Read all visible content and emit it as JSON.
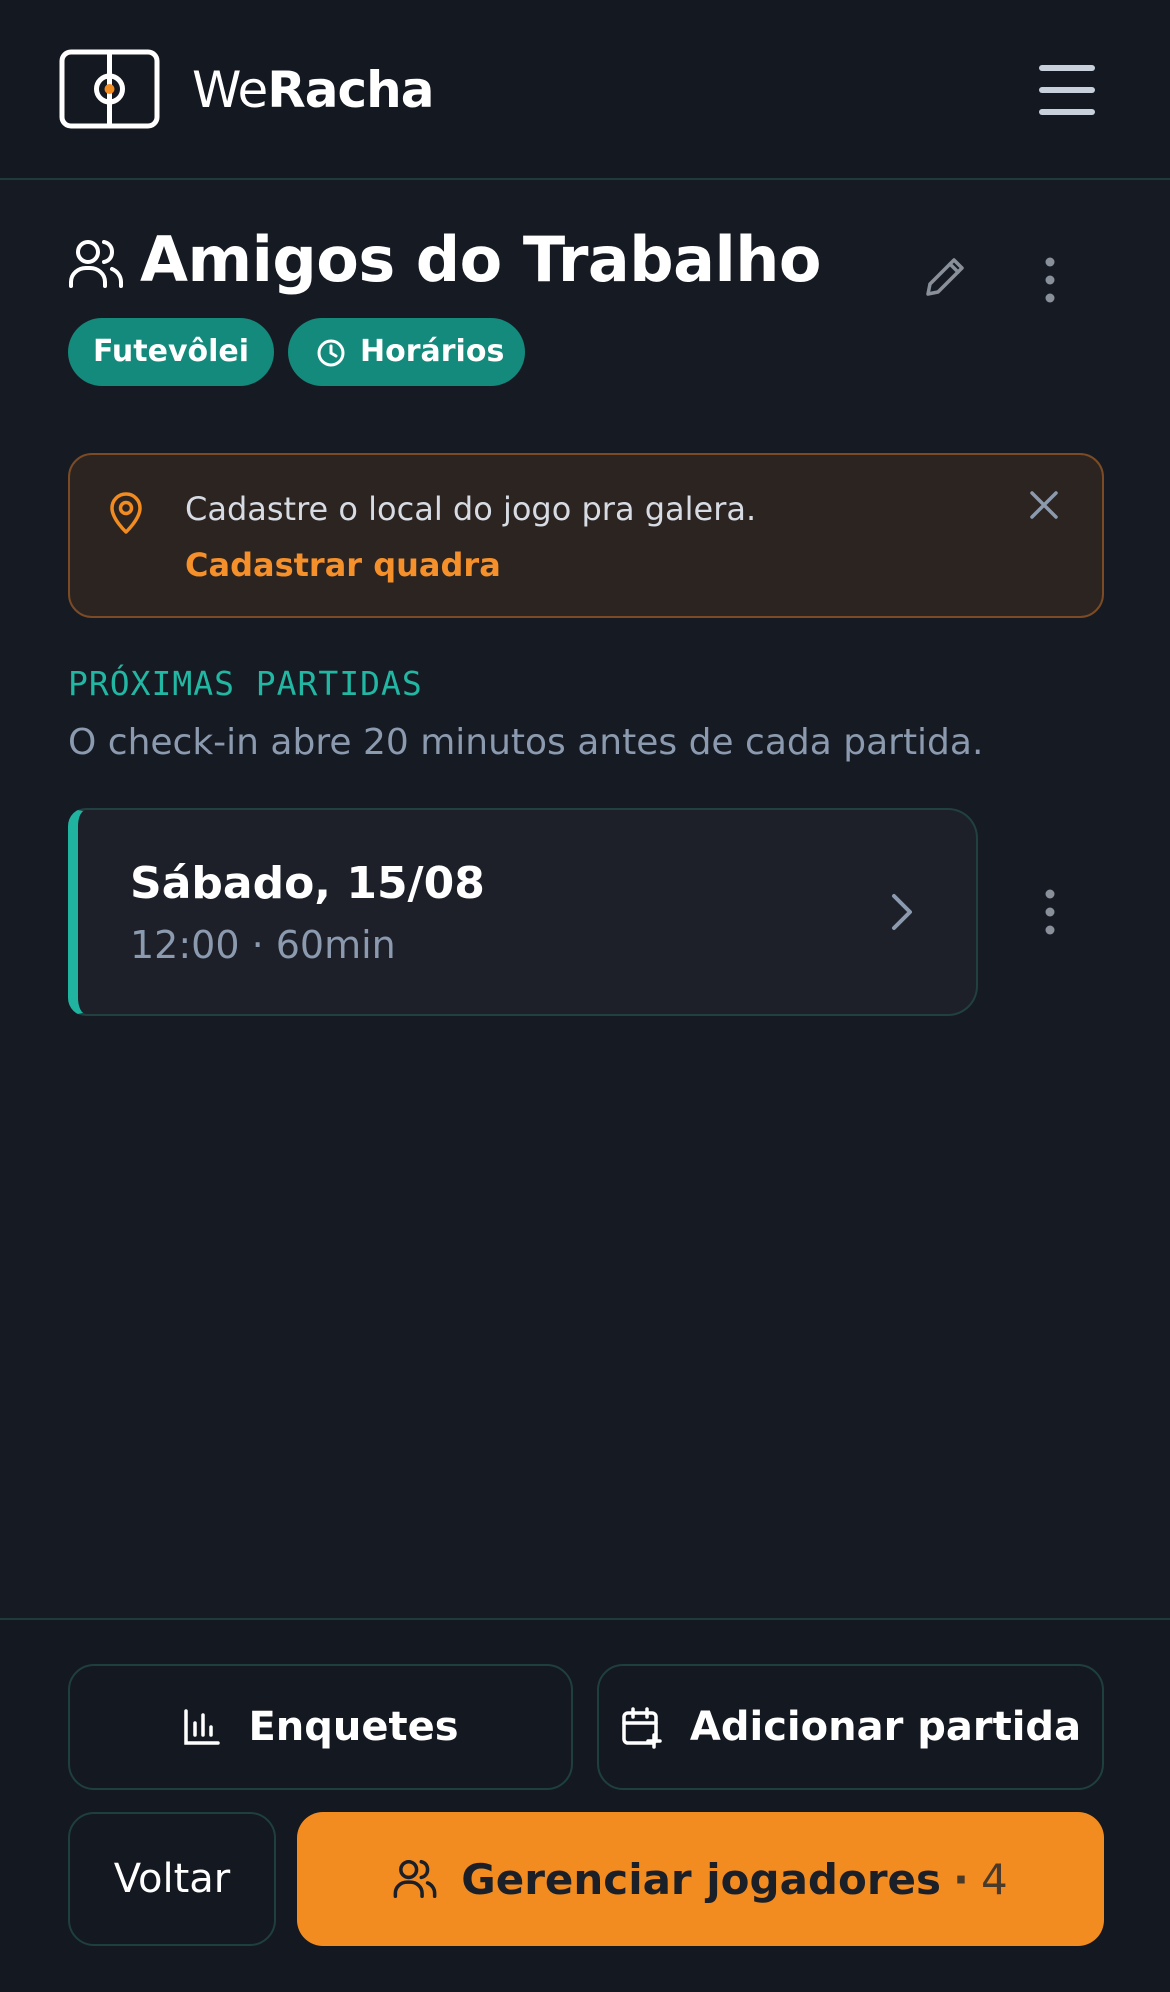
{
  "header": {
    "brand_light": "We",
    "brand_bold": "Racha",
    "icons": {
      "logo": "field-logo-icon",
      "menu": "hamburger-menu-icon"
    }
  },
  "group": {
    "title": "Amigos do Trabalho",
    "icon": "group-users-icon",
    "sport_chip": "Futevôlei",
    "hours_chip": "Horários"
  },
  "alert": {
    "message": "Cadastre o local do jogo pra galera.",
    "action": "Cadastrar quadra",
    "icon": "location-pin-icon"
  },
  "upcoming": {
    "label": "PRÓXIMAS PARTIDAS",
    "subtitle": "O check-in abre 20 minutos antes de cada partida.",
    "matches": [
      {
        "date": "Sábado, 15/08",
        "time": "12:00 · 60min"
      }
    ]
  },
  "footer": {
    "polls": "Enquetes",
    "add_match": "Adicionar partida",
    "back": "Voltar",
    "manage_players": "Gerenciar jogadores",
    "players_count": "4"
  },
  "colors": {
    "background": "#161a23",
    "accent_teal": "#138a7c",
    "accent_orange": "#f38c20",
    "alert_bg": "#2c2421"
  }
}
